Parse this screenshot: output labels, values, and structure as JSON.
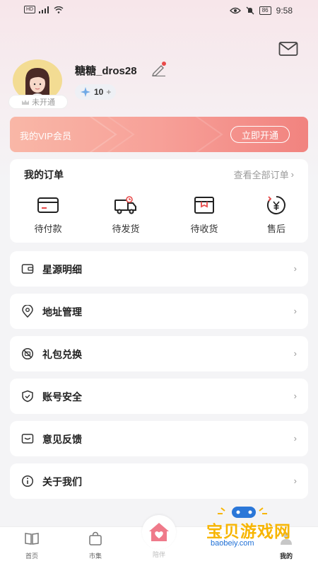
{
  "status_bar": {
    "time": "9:58",
    "battery": "86",
    "left_badge": "HD"
  },
  "profile": {
    "username": "糖糖_dros28",
    "avatar_badge": "未开通",
    "points": "10",
    "points_plus": "+"
  },
  "vip": {
    "label": "我的VIP会员",
    "button": "立即开通"
  },
  "orders": {
    "title": "我的订单",
    "view_all": "查看全部订单",
    "items": [
      {
        "label": "待付款",
        "icon": "wallet-card-icon"
      },
      {
        "label": "待发货",
        "icon": "delivery-truck-icon"
      },
      {
        "label": "待收货",
        "icon": "package-box-icon"
      },
      {
        "label": "售后",
        "icon": "yuan-refund-icon"
      }
    ]
  },
  "menu": [
    {
      "label": "星源明细",
      "icon": "wallet-icon"
    },
    {
      "label": "地址管理",
      "icon": "location-pin-icon"
    },
    {
      "label": "礼包兑换",
      "icon": "no-ticket-icon"
    },
    {
      "label": "账号安全",
      "icon": "shield-icon"
    },
    {
      "label": "意见反馈",
      "icon": "feedback-envelope-icon"
    },
    {
      "label": "关于我们",
      "icon": "info-icon"
    }
  ],
  "bottom_nav": [
    {
      "label": "首页"
    },
    {
      "label": "市集"
    },
    {
      "label": "陪伴"
    },
    {
      "label": ""
    },
    {
      "label": "我的"
    }
  ],
  "watermark": {
    "text": "宝贝游戏网",
    "url": "baobeiy.com"
  },
  "colors": {
    "accent": "#f1837f",
    "vip_gradient_start": "#f9b7a7",
    "center_tab": "#ef7a8a",
    "page_bg": "#f4f4f6"
  }
}
